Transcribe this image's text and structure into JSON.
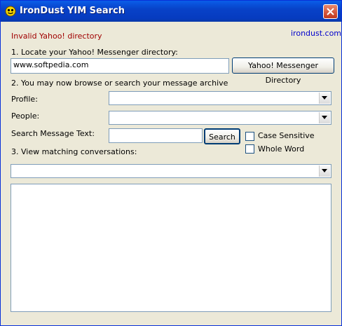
{
  "window": {
    "title": "IronDust YIM Search"
  },
  "status": {
    "message": "Invalid Yahoo! directory",
    "link": "irondust.com"
  },
  "step1": {
    "label": "1. Locate your Yahoo! Messenger directory:",
    "directory_value": "www.softpedia.com",
    "button_label": "Yahoo! Messenger Directory"
  },
  "step2": {
    "label": "2. You may now browse or search your message archive",
    "profile_label": "Profile:",
    "profile_value": "",
    "people_label": "People:",
    "people_value": "",
    "search_label": "Search Message Text:",
    "search_value": "",
    "search_button": "Search",
    "case_sensitive_label": "Case Sensitive",
    "case_sensitive_checked": false,
    "whole_word_label": "Whole Word",
    "whole_word_checked": false
  },
  "step3": {
    "label": "3. View matching conversations:",
    "conversation_value": ""
  },
  "icons": {
    "app": "yim-smiley-icon",
    "close": "close-icon",
    "dropdown": "chevron-down-icon"
  },
  "colors": {
    "titlebar": "#0842c8",
    "status_error": "#a00000",
    "link": "#0000cc",
    "close_button": "#d3543a"
  }
}
